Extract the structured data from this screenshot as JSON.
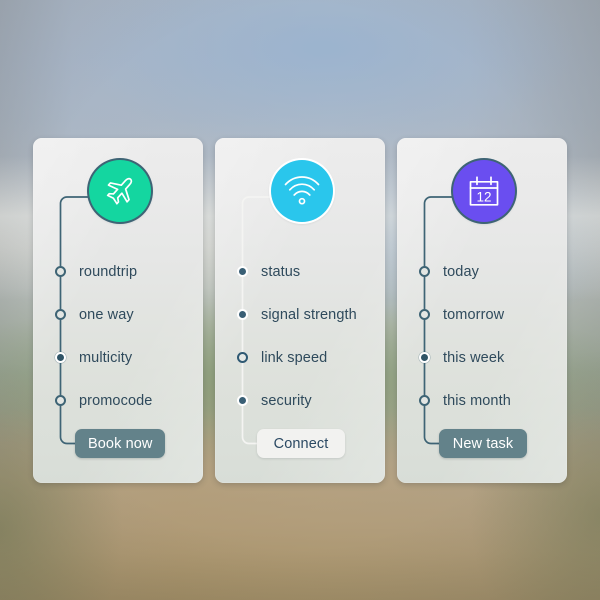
{
  "background": {
    "description": "blurred outdoor landscape photo, blue-grey sky over green field and tan ground",
    "sky_color": "#a9b6c6",
    "field_color": "#94a488",
    "ground_color": "#b3a184"
  },
  "cards": [
    {
      "id": "flights",
      "icon_name": "airplane-icon",
      "icon_color": "#14d6a0",
      "icon_ring_color": "#3e6475",
      "theme": "dark",
      "connector_color": "#3e6475",
      "options": [
        {
          "label": "roundtrip",
          "selected": false
        },
        {
          "label": "one way",
          "selected": false
        },
        {
          "label": "multicity",
          "selected": true
        },
        {
          "label": "promocode",
          "selected": false
        }
      ],
      "button": {
        "label": "Book now",
        "style": "dark",
        "bg": "#63828a",
        "fg": "#ffffff"
      }
    },
    {
      "id": "wifi",
      "icon_name": "wifi-icon",
      "icon_color": "#2ac6ec",
      "icon_ring_color": "#ffffff",
      "theme": "light",
      "connector_color": "#f4f4f2",
      "options": [
        {
          "label": "status",
          "selected": false
        },
        {
          "label": "signal strength",
          "selected": false
        },
        {
          "label": "link speed",
          "selected": true
        },
        {
          "label": "security",
          "selected": false
        }
      ],
      "button": {
        "label": "Connect",
        "style": "light",
        "bg": "#f2f2f0",
        "fg": "#2b4963"
      }
    },
    {
      "id": "calendar",
      "icon_name": "calendar-icon",
      "icon_color": "#6a4ef0",
      "icon_ring_color": "#3e6475",
      "icon_day": "12",
      "theme": "dark",
      "connector_color": "#3e6475",
      "options": [
        {
          "label": "today",
          "selected": false
        },
        {
          "label": "tomorrow",
          "selected": false
        },
        {
          "label": "this week",
          "selected": true
        },
        {
          "label": "this month",
          "selected": false
        }
      ],
      "button": {
        "label": "New task",
        "style": "dark",
        "bg": "#63828a",
        "fg": "#ffffff"
      }
    }
  ]
}
